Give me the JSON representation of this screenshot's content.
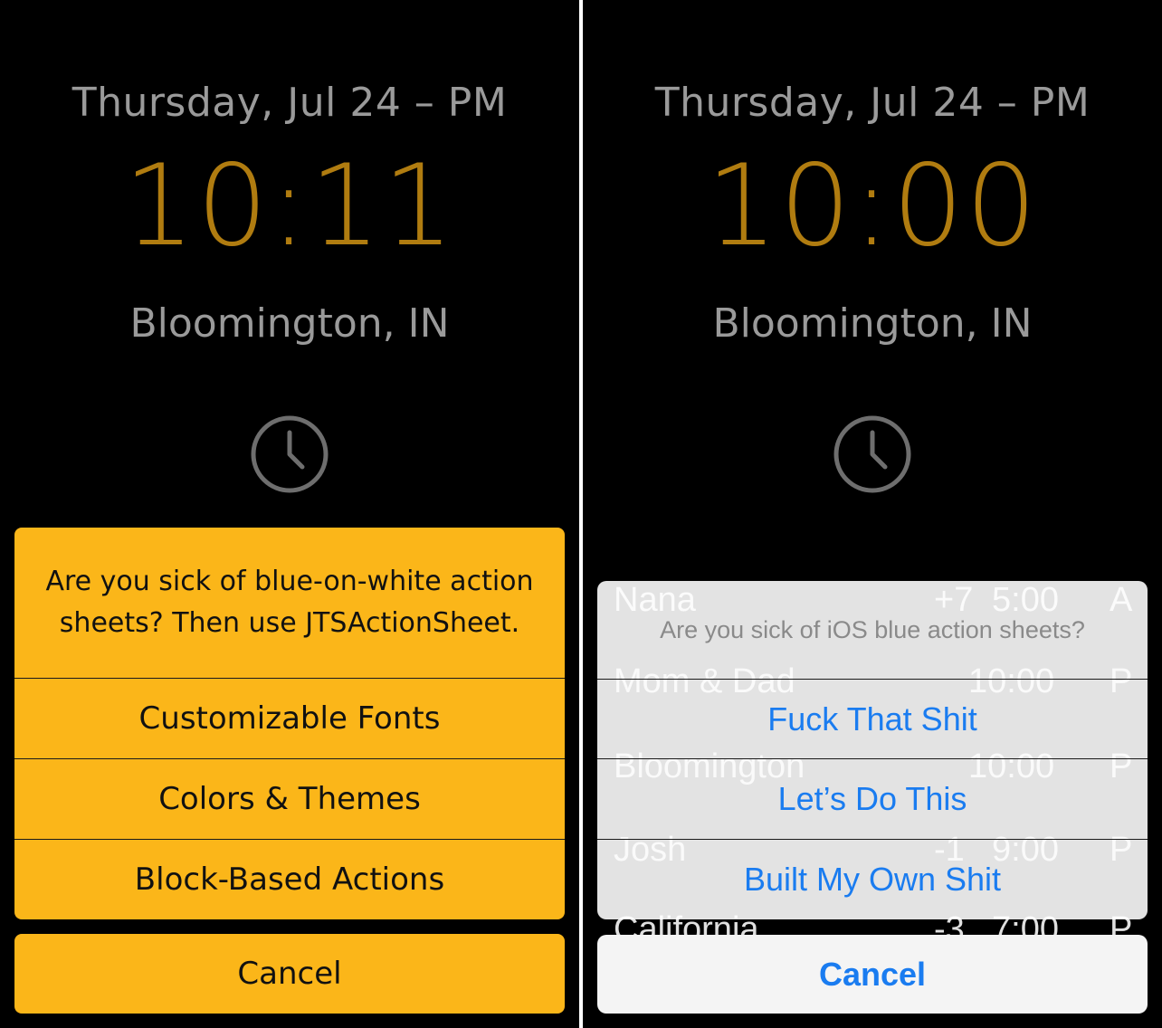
{
  "left": {
    "date": "Thursday, Jul 24 – PM",
    "time": "10:11",
    "location": "Bloomington, IN",
    "sheet": {
      "message": "Are you sick of blue-on-white action sheets? Then use JTSActionSheet.",
      "buttons": [
        "Customizable Fonts",
        "Colors & Themes",
        "Block-Based Actions"
      ],
      "cancel": "Cancel"
    },
    "colors": {
      "accent": "#fbb619",
      "time": "#b07c10"
    }
  },
  "right": {
    "date": "Thursday, Jul 24 – PM",
    "time": "10:00",
    "location": "Bloomington, IN",
    "background_rows": [
      {
        "name": "Nana",
        "offset": "+7",
        "time": "5:00",
        "ampm": "A"
      },
      {
        "name": "Mom & Dad",
        "offset": "",
        "time": "10:00",
        "ampm": "P"
      },
      {
        "name": "Bloomington",
        "offset": "",
        "time": "10:00",
        "ampm": "P"
      },
      {
        "name": "Josh",
        "offset": "-1",
        "time": "9:00",
        "ampm": "P"
      },
      {
        "name": "California",
        "offset": "-3",
        "time": "7:00",
        "ampm": "P"
      }
    ],
    "sheet": {
      "message": "Are you sick of iOS blue action sheets?",
      "buttons": [
        "Fuck That Shit",
        "Let’s Do This",
        "Built My Own Shit"
      ],
      "cancel": "Cancel"
    },
    "colors": {
      "accent": "#1a7cf0",
      "time": "#b07c10"
    }
  }
}
